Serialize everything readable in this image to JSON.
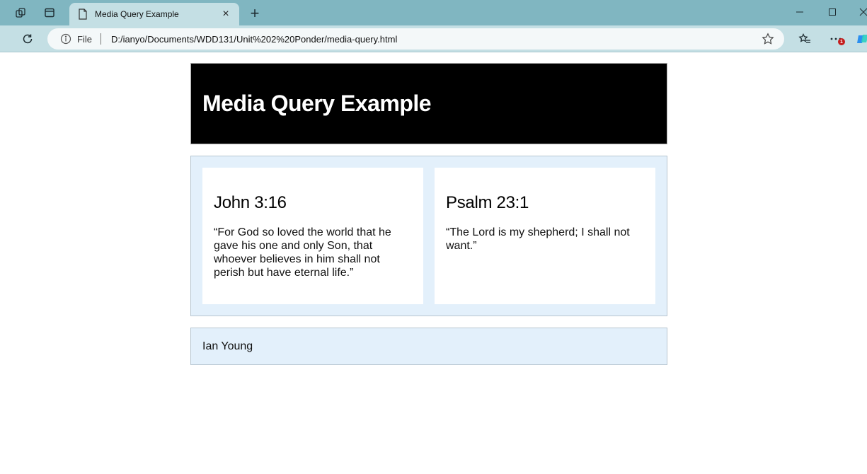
{
  "browser": {
    "tab_title": "Media Query Example",
    "tab_close": "×",
    "new_tab": "+",
    "address_scheme": "File",
    "address_url": "D:/ianyo/Documents/WDD131/Unit%202%20Ponder/media-query.html",
    "notification_count": "1"
  },
  "page": {
    "header_title": "Media Query Example",
    "cards": [
      {
        "heading": "John 3:16",
        "text": "“For God so loved the world that he gave his one and only Son, that whoever believes in him shall not perish but have eternal life.”"
      },
      {
        "heading": "Psalm 23:1",
        "text": "“The Lord is my shepherd; I shall not want.”"
      }
    ],
    "footer_text": "Ian Young"
  },
  "colors": {
    "titlebar": "#80b6c1",
    "toolbar": "#c4dfe4",
    "header_bg": "#000000",
    "panel_bg": "#e3f0fb"
  }
}
